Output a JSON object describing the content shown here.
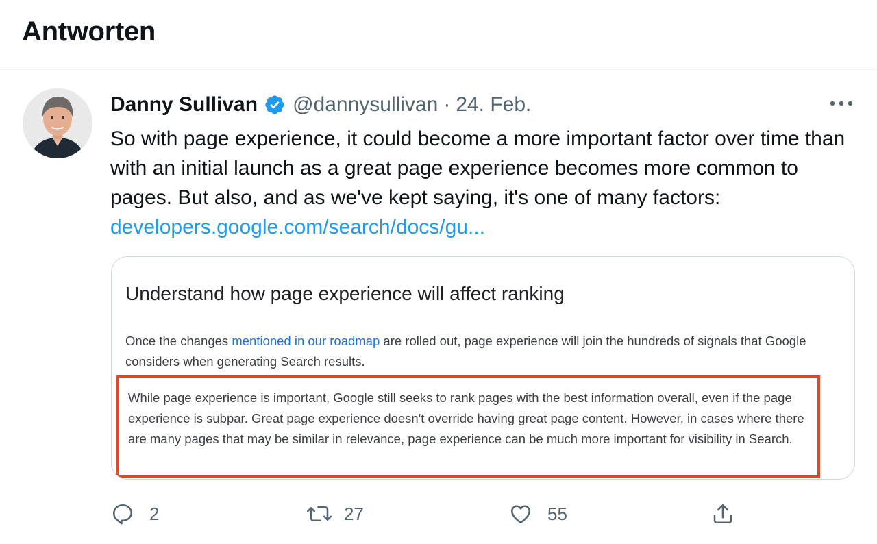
{
  "header": {
    "title": "Antworten"
  },
  "tweet": {
    "author_name": "Danny Sullivan",
    "verified_icon": "verified-badge-icon",
    "handle": "@dannysullivan",
    "separator": "·",
    "date": "24. Feb.",
    "text": "So with page experience, it could become a more important factor over time than with an initial launch as a great page experience becomes more common to pages. But also, and as we've kept saying, it's one of many factors: ",
    "link_text": "developers.google.com/search/docs/gu...",
    "card": {
      "heading": "Understand how page experience will affect ranking",
      "p1_before": "Once the changes ",
      "p1_link": "mentioned in our roadmap",
      "p1_after": " are rolled out, page experience will join the hundreds of signals that Google considers when generating Search results.",
      "p2": "While page experience is important, Google still seeks to rank pages with the best information overall, even if the page experience is subpar. Great page experience doesn't override having great page content. However, in cases where there are many pages that may be similar in relevance, page experience can be much more important for visibility in Search."
    },
    "actions": {
      "reply_count": "2",
      "retweet_count": "27",
      "like_count": "55"
    },
    "colors": {
      "link": "#1d9bf0",
      "verified": "#1d9bf0",
      "highlight_border": "#d94a2b",
      "muted": "#536471"
    }
  }
}
